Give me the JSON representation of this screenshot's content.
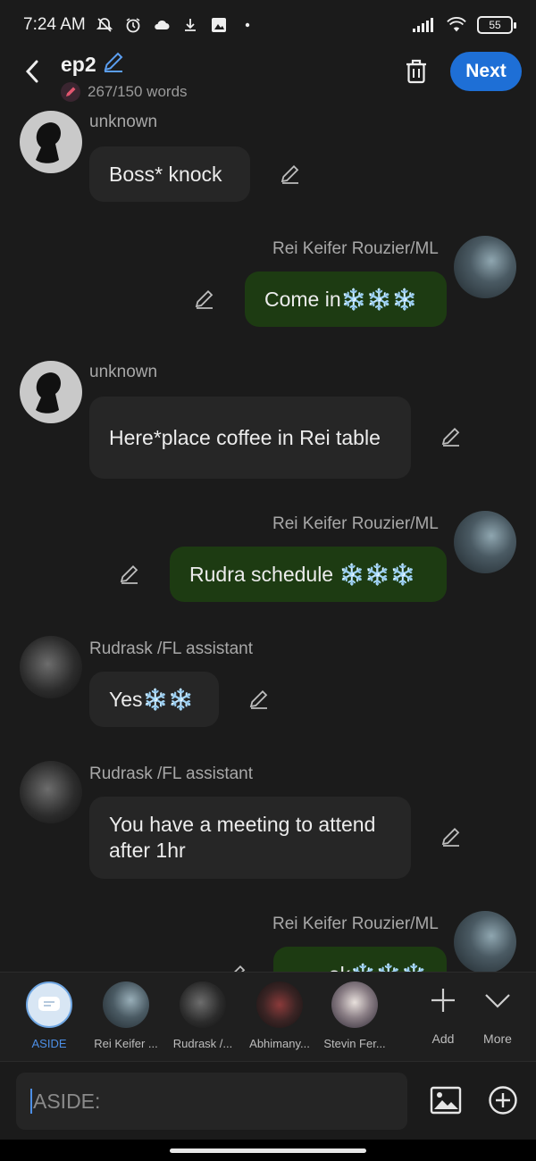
{
  "status_bar": {
    "time": "7:24 AM",
    "battery": "55"
  },
  "header": {
    "title": "ep2",
    "word_count": "267/150 words",
    "next_label": "Next"
  },
  "messages": [
    {
      "sender": "unknown",
      "text": "Boss* knock"
    },
    {
      "sender": "Rei Keifer Rouzier/ML",
      "text": "Come in❄️❄️❄️"
    },
    {
      "sender": "unknown",
      "text": "Here*place coffee in Rei table"
    },
    {
      "sender": "Rei Keifer Rouzier/ML",
      "text": "Rudra schedule ❄️❄️❄️"
    },
    {
      "sender": "Rudrask /FL assistant",
      "text": "Yes❄️❄️"
    },
    {
      "sender": "Rudrask /FL assistant",
      "text": "You have a meeting to attend after 1hr"
    },
    {
      "sender": "Rei Keifer Rouzier/ML",
      "text": "ok❄️❄️❄️"
    }
  ],
  "characters": [
    {
      "label": "ASIDE",
      "active": true
    },
    {
      "label": "Rei Keifer ..."
    },
    {
      "label": "Rudrask /..."
    },
    {
      "label": "Abhimany..."
    },
    {
      "label": "Stevin Fer..."
    }
  ],
  "tools": {
    "add_label": "Add",
    "more_label": "More"
  },
  "input": {
    "value": "ASIDE:"
  },
  "colors": {
    "accent": "#1e6fd6",
    "bubble_self": "#1d3b12",
    "bubble_other": "#262626",
    "background": "#1b1b1b"
  }
}
